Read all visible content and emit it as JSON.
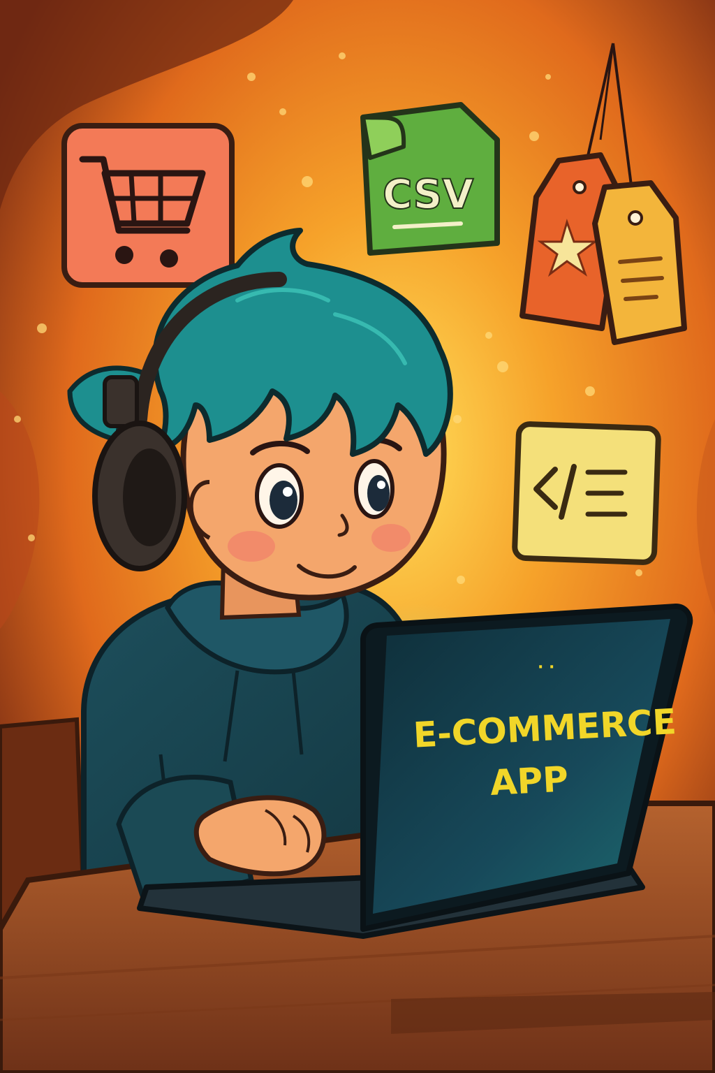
{
  "scene": {
    "background_colors": {
      "outer": "#7a2d14",
      "glow_center": "#ffd34a",
      "mid": "#f08a22"
    },
    "hair_color": "#1d8f8f",
    "hoodie_color": "#1b4a55",
    "skin_color": "#f4a66c",
    "desk_color": "#a0532a"
  },
  "icons": {
    "cart": {
      "name": "shopping-cart-icon",
      "color": "#f37a57"
    },
    "csv": {
      "name": "csv-file-icon",
      "label": "CSV",
      "color": "#5fae3f"
    },
    "tags": {
      "name": "price-tags-icon",
      "color_left": "#e8632a",
      "color_right": "#f3b53b"
    },
    "code": {
      "name": "code-window-icon",
      "color": "#f4e07a"
    }
  },
  "laptop": {
    "title_line1": "E-COMMERCE",
    "title_line2": "APP",
    "text_color": "#f1d629",
    "screen_color": "#143c48"
  }
}
